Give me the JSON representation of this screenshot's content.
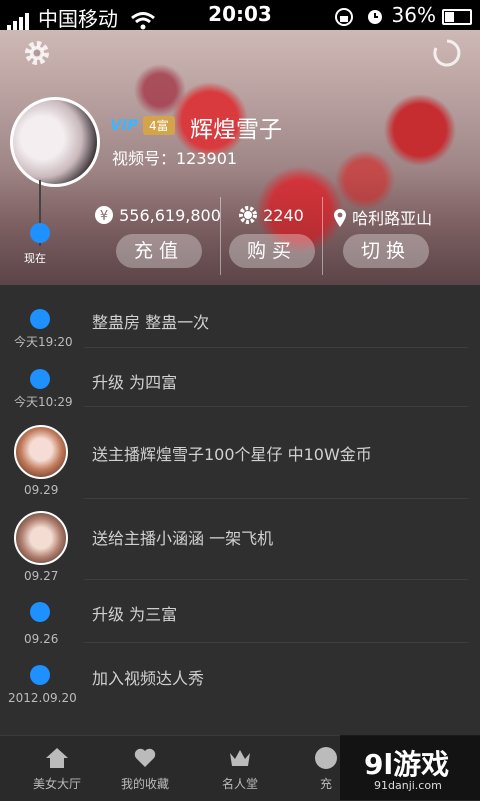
{
  "status_bar": {
    "carrier": "中国移动",
    "time": "20:03",
    "battery": "36%"
  },
  "profile": {
    "vip_badge": "VIP",
    "rich_badge": "4富",
    "username": "辉煌雪子",
    "video_id_label": "视频号：123901",
    "coins": "556,619,800",
    "stars": "2240",
    "location": "哈利路亚山",
    "btn_recharge": "充值",
    "btn_buy": "购买",
    "btn_switch": "切换",
    "now_label": "现在"
  },
  "timeline": [
    {
      "time": "今天19:20",
      "text": "整蛊房 整蛊一次",
      "type": "dot"
    },
    {
      "time": "今天10:29",
      "text": "升级 为四富",
      "type": "dot"
    },
    {
      "time": "09.29",
      "text": "送主播辉煌雪子100个星仔 中10W金币",
      "type": "avatar"
    },
    {
      "time": "09.27",
      "text": "送给主播小涵涵 一架飞机",
      "type": "avatar"
    },
    {
      "time": "09.26",
      "text": "升级 为三富",
      "type": "dot"
    },
    {
      "time": "2012.09.20",
      "text": "加入视频达人秀",
      "type": "dot"
    }
  ],
  "tabs": [
    {
      "label": "美女大厅",
      "icon": "home-icon"
    },
    {
      "label": "我的收藏",
      "icon": "heart-icon"
    },
    {
      "label": "名人堂",
      "icon": "crown-icon"
    },
    {
      "label": "充",
      "icon": "yuan-icon"
    }
  ],
  "watermark": {
    "big": "9l游戏",
    "small": "91danji.com"
  }
}
